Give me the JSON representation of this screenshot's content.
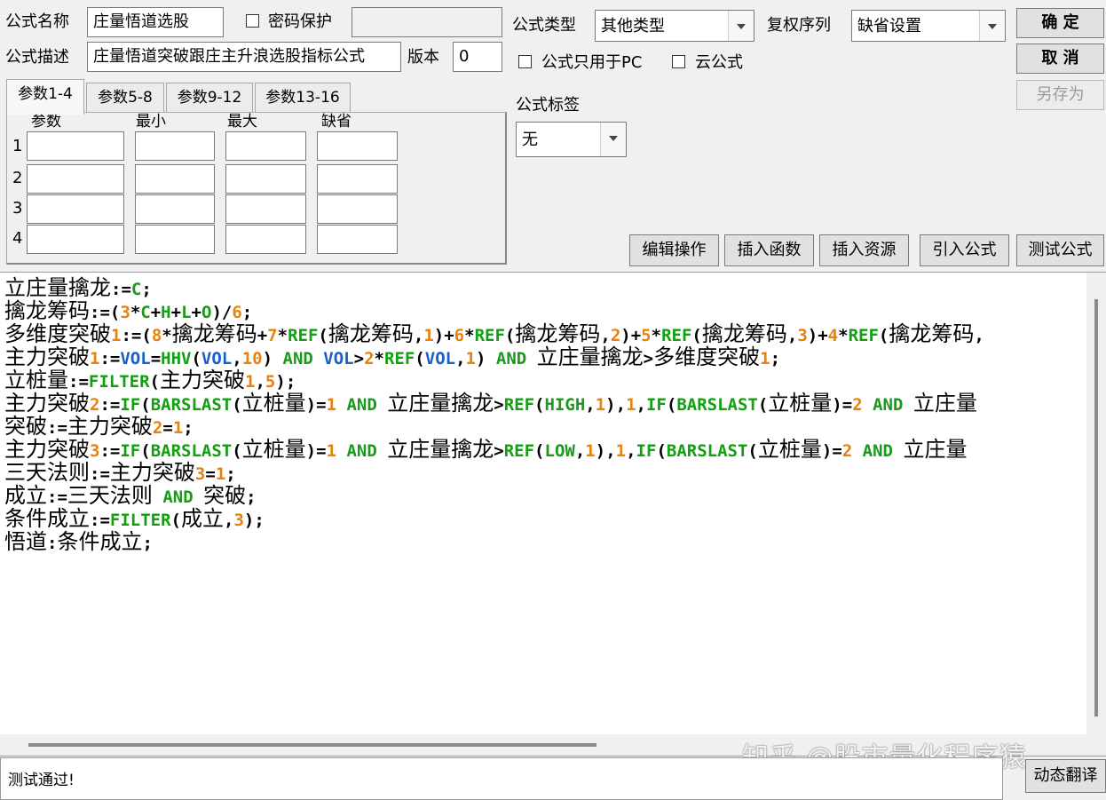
{
  "header": {
    "name_label": "公式名称",
    "name_value": "庄量悟道选股",
    "password_label": "密码保护",
    "password_value": "",
    "desc_label": "公式描述",
    "desc_value": "庄量悟道突破跟庄主升浪选股指标公式",
    "version_label": "版本",
    "version_value": "0",
    "type_label": "公式类型",
    "type_value": "其他类型",
    "rights_label": "复权序列",
    "rights_value": "缺省设置",
    "pc_only_label": "公式只用于PC",
    "cloud_label": "云公式",
    "tag_label": "公式标签",
    "tag_value": "无"
  },
  "buttons": {
    "ok": "确  定",
    "cancel": "取  消",
    "save_as": "另存为",
    "edit_ops": "编辑操作",
    "insert_func": "插入函数",
    "insert_res": "插入资源",
    "import_formula": "引入公式",
    "test_formula": "测试公式",
    "dynamic_translate": "动态翻译"
  },
  "params": {
    "tabs": [
      "参数1-4",
      "参数5-8",
      "参数9-12",
      "参数13-16"
    ],
    "columns": [
      "参数",
      "最小",
      "最大",
      "缺省"
    ],
    "rows": [
      "1",
      "2",
      "3",
      "4"
    ]
  },
  "code": [
    "立庄量擒龙:=C;",
    "擒龙筹码:=(3*C+H+L+O)/6;",
    "多维度突破1:=(8*擒龙筹码+7*REF(擒龙筹码,1)+6*REF(擒龙筹码,2)+5*REF(擒龙筹码,3)+4*REF(擒龙筹码,",
    "主力突破1:=VOL=HHV(VOL,10) AND VOL>2*REF(VOL,1) AND 立庄量擒龙>多维度突破1;",
    "立桩量:=FILTER(主力突破1,5);",
    "主力突破2:=IF(BARSLAST(立桩量)=1 AND 立庄量擒龙>REF(HIGH,1),1,IF(BARSLAST(立桩量)=2 AND 立庄量",
    "突破:=主力突破2=1;",
    "主力突破3:=IF(BARSLAST(立桩量)=1 AND 立庄量擒龙>REF(LOW,1),1,IF(BARSLAST(立桩量)=2 AND 立庄量",
    "三天法则:=主力突破3=1;",
    "成立:=三天法则 AND 突破;",
    "条件成立:=FILTER(成立,3);",
    "悟道:条件成立;"
  ],
  "status_text": "测试通过!",
  "watermark": "知乎 @股市量化程序猿",
  "colors": {
    "number": "#e8820c",
    "keyword": "#1a9a1a",
    "function": "#12a012",
    "variable": "#1a60c8"
  }
}
